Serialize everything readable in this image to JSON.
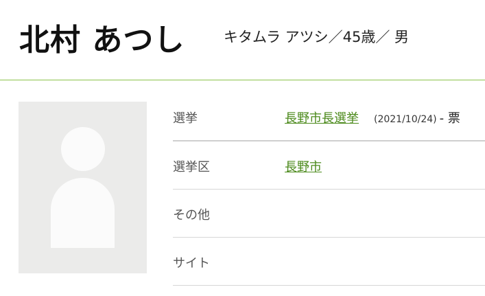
{
  "candidate": {
    "name": "北村 あつし",
    "kana_age_gender": "キタムラ アツシ／45歳／ 男"
  },
  "info": {
    "election": {
      "label": "選挙",
      "value": "長野市長選挙",
      "date": "(2021/10/24)",
      "result": "- 票"
    },
    "district": {
      "label": "選挙区",
      "value": "長野市"
    },
    "other": {
      "label": "その他"
    },
    "site": {
      "label": "サイト"
    }
  },
  "colors": {
    "accent": "#8bc34a",
    "link": "#4c8a1c",
    "photo_bg": "#ebebea"
  }
}
